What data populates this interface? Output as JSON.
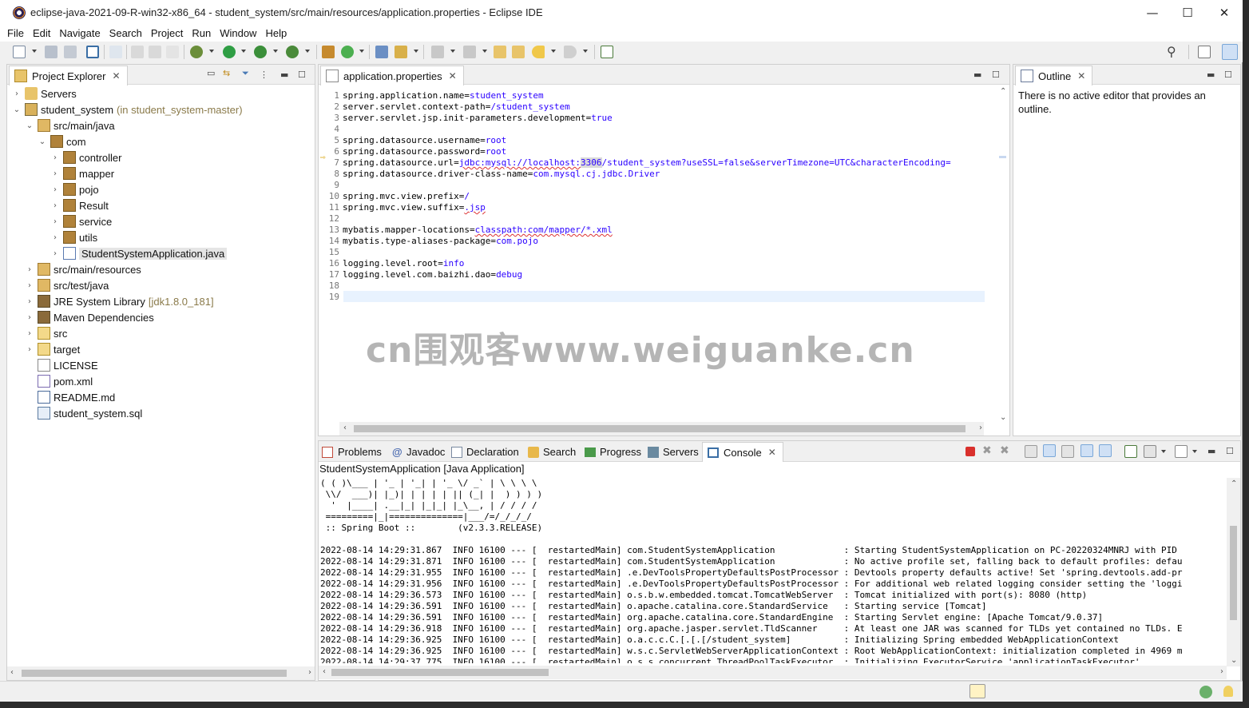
{
  "window": {
    "title": "eclipse-java-2021-09-R-win32-x86_64 - student_system/src/main/resources/application.properties - Eclipse IDE",
    "minimize": "—",
    "maximize": "☐",
    "close": "✕"
  },
  "menu": [
    "File",
    "Edit",
    "Navigate",
    "Search",
    "Project",
    "Run",
    "Window",
    "Help"
  ],
  "project_explorer": {
    "tab_label": "Project Explorer",
    "items": [
      {
        "label": "Servers",
        "extra": "",
        "icon": "folder-icon"
      },
      {
        "label": "student_system",
        "extra": "(in student_system-master)",
        "icon": "project-icon"
      },
      {
        "label": "src/main/java",
        "extra": "",
        "icon": "source-folder-icon"
      },
      {
        "label": "com",
        "extra": "",
        "icon": "package-icon"
      },
      {
        "label": "controller",
        "extra": "",
        "icon": "package-icon"
      },
      {
        "label": "mapper",
        "extra": "",
        "icon": "package-icon"
      },
      {
        "label": "pojo",
        "extra": "",
        "icon": "package-icon"
      },
      {
        "label": "Result",
        "extra": "",
        "icon": "package-icon"
      },
      {
        "label": "service",
        "extra": "",
        "icon": "package-icon"
      },
      {
        "label": "utils",
        "extra": "",
        "icon": "package-icon"
      },
      {
        "label": "StudentSystemApplication.java",
        "extra": "",
        "icon": "java-file-icon"
      },
      {
        "label": "src/main/resources",
        "extra": "",
        "icon": "source-folder-icon"
      },
      {
        "label": "src/test/java",
        "extra": "",
        "icon": "source-folder-icon"
      },
      {
        "label": "JRE System Library",
        "extra": "[jdk1.8.0_181]",
        "icon": "library-icon"
      },
      {
        "label": "Maven Dependencies",
        "extra": "",
        "icon": "library-icon"
      },
      {
        "label": "src",
        "extra": "",
        "icon": "folder-icon"
      },
      {
        "label": "target",
        "extra": "",
        "icon": "folder-icon"
      },
      {
        "label": "LICENSE",
        "extra": "",
        "icon": "file-icon"
      },
      {
        "label": "pom.xml",
        "extra": "",
        "icon": "xml-file-icon"
      },
      {
        "label": "README.md",
        "extra": "",
        "icon": "md-file-icon"
      },
      {
        "label": "student_system.sql",
        "extra": "",
        "icon": "sql-file-icon"
      }
    ]
  },
  "editor": {
    "tab_label": "application.properties",
    "lines": [
      {
        "n": "1",
        "key": "spring.application.name=",
        "val": "student_system"
      },
      {
        "n": "2",
        "key": "server.servlet.context-path=",
        "val": "/student_system"
      },
      {
        "n": "3",
        "key": "server.servlet.jsp.init-parameters.development=",
        "val": "true"
      },
      {
        "n": "4",
        "key": "",
        "val": ""
      },
      {
        "n": "5",
        "key": "spring.datasource.username=",
        "val": "root"
      },
      {
        "n": "6",
        "key": "spring.datasource.password=",
        "val": "root"
      },
      {
        "n": "7",
        "key": "spring.datasource.url=",
        "val": "jdbc:mysql://localhost:3306/student_system?useSSL=false&serverTimezone=UTC&characterEncoding="
      },
      {
        "n": "8",
        "key": "spring.datasource.driver-class-name=",
        "val": "com.mysql.cj.jdbc.Driver"
      },
      {
        "n": "9",
        "key": "",
        "val": ""
      },
      {
        "n": "10",
        "key": "spring.mvc.view.prefix=",
        "val": "/"
      },
      {
        "n": "11",
        "key": "spring.mvc.view.suffix=",
        "val": ".jsp"
      },
      {
        "n": "12",
        "key": "",
        "val": ""
      },
      {
        "n": "13",
        "key": "mybatis.mapper-locations=",
        "val": "classpath:com/mapper/*.xml"
      },
      {
        "n": "14",
        "key": "mybatis.type-aliases-package=",
        "val": "com.pojo"
      },
      {
        "n": "15",
        "key": "",
        "val": ""
      },
      {
        "n": "16",
        "key": "logging.level.root=",
        "val": "info"
      },
      {
        "n": "17",
        "key": "logging.level.com.baizhi.dao=",
        "val": "debug"
      },
      {
        "n": "18",
        "key": "",
        "val": ""
      },
      {
        "n": "19",
        "key": "",
        "val": ""
      }
    ]
  },
  "outline": {
    "tab_label": "Outline",
    "message": "There is no active editor that provides an outline."
  },
  "bottom_tabs": [
    "Problems",
    "Javadoc",
    "Declaration",
    "Search",
    "Progress",
    "Servers",
    "Console"
  ],
  "console": {
    "header": "StudentSystemApplication [Java Application]",
    "banner": [
      "( ( )\\___ | '_ | '_| | '_ \\/ _` | \\ \\ \\ \\",
      " \\\\/  ___)| |_)| | | | | || (_| |  ) ) ) )",
      "  '  |____| .__|_| |_|_| |_\\__, | / / / /",
      " =========|_|==============|___/=/_/_/_/",
      " :: Spring Boot ::        (v2.3.3.RELEASE)"
    ],
    "logs": [
      "2022-08-14 14:29:31.867  INFO 16100 --- [  restartedMain] com.StudentSystemApplication             : Starting StudentSystemApplication on PC-20220324MNRJ with PID",
      "2022-08-14 14:29:31.871  INFO 16100 --- [  restartedMain] com.StudentSystemApplication             : No active profile set, falling back to default profiles: defau",
      "2022-08-14 14:29:31.955  INFO 16100 --- [  restartedMain] .e.DevToolsPropertyDefaultsPostProcessor : Devtools property defaults active! Set 'spring.devtools.add-pr",
      "2022-08-14 14:29:31.956  INFO 16100 --- [  restartedMain] .e.DevToolsPropertyDefaultsPostProcessor : For additional web related logging consider setting the 'loggi",
      "2022-08-14 14:29:36.573  INFO 16100 --- [  restartedMain] o.s.b.w.embedded.tomcat.TomcatWebServer  : Tomcat initialized with port(s): 8080 (http)",
      "2022-08-14 14:29:36.591  INFO 16100 --- [  restartedMain] o.apache.catalina.core.StandardService   : Starting service [Tomcat]",
      "2022-08-14 14:29:36.591  INFO 16100 --- [  restartedMain] org.apache.catalina.core.StandardEngine  : Starting Servlet engine: [Apache Tomcat/9.0.37]",
      "2022-08-14 14:29:36.918  INFO 16100 --- [  restartedMain] org.apache.jasper.servlet.TldScanner     : At least one JAR was scanned for TLDs yet contained no TLDs. E",
      "2022-08-14 14:29:36.925  INFO 16100 --- [  restartedMain] o.a.c.c.C.[.[.[/student_system]          : Initializing Spring embedded WebApplicationContext",
      "2022-08-14 14:29:36.925  INFO 16100 --- [  restartedMain] w.s.c.ServletWebServerApplicationContext : Root WebApplicationContext: initialization completed in 4969 m",
      "2022-08-14 14:29:37.775  INFO 16100 --- [  restartedMain] o.s.s.concurrent.ThreadPoolTaskExecutor  : Initializing ExecutorService 'applicationTaskExecutor'"
    ]
  },
  "watermark": "cn围观客www.weiguanke.cn",
  "colors": {
    "value_text": "#2a00ff",
    "folder": "#e8c46a",
    "package": "#b0823a",
    "terminate_red": "#d9302c"
  }
}
